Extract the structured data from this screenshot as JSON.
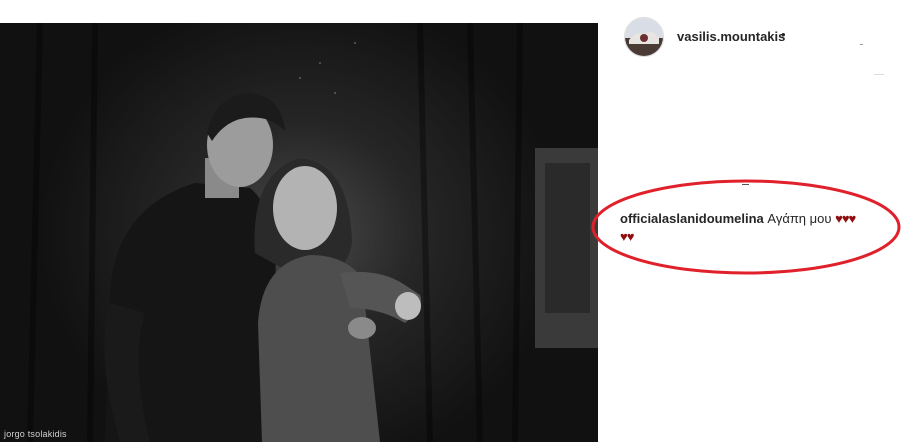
{
  "post": {
    "photo_credit": "jorgo tsolakidis"
  },
  "header": {
    "username": "vasilis.mountakis",
    "separator": "•"
  },
  "comment": {
    "username": "officialaslanidoumelina",
    "text": "Αγάπη μου",
    "hearts_line1": "♥♥♥",
    "hearts_line2": "♥♥"
  },
  "colors": {
    "highlight_ellipse": "#e0202a",
    "heart": "#8e0d0d",
    "text": "#262626"
  }
}
